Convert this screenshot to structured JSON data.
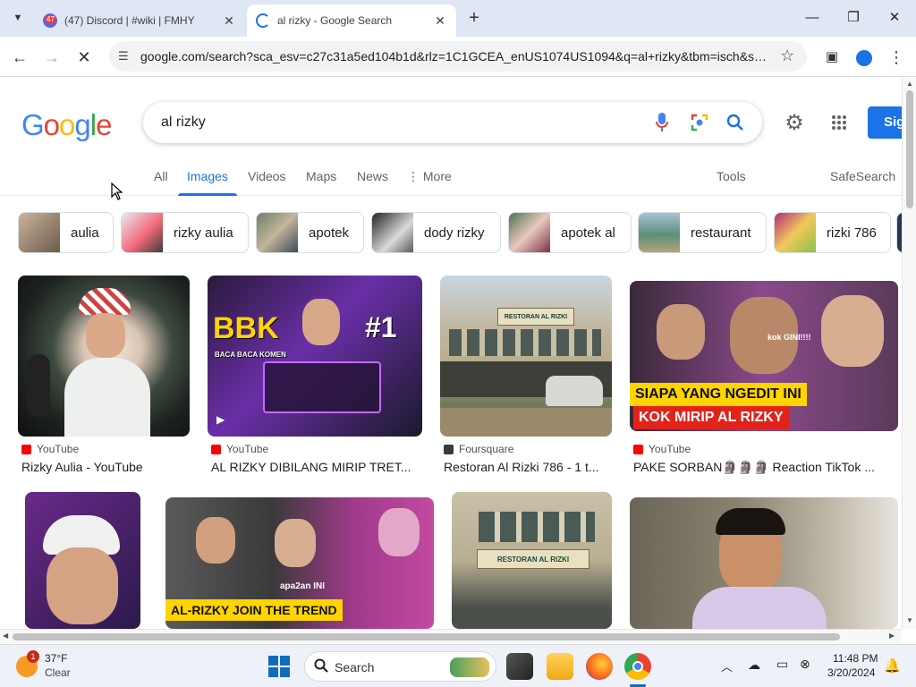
{
  "browser": {
    "tabs": [
      {
        "title": "(47) Discord | #wiki | FMHY",
        "favicon_badge": "47"
      },
      {
        "title": "al rizky - Google Search"
      }
    ],
    "url": "google.com/search?sca_esv=c27c31a5ed104b1d&rlz=1C1GCEA_enUS1074US1094&q=al+rizky&tbm=isch&sour..."
  },
  "google": {
    "logo": "Google",
    "query": "al rizky",
    "sign_in_label": "Sig",
    "tabs": {
      "all": "All",
      "images": "Images",
      "videos": "Videos",
      "maps": "Maps",
      "news": "News",
      "more": "More"
    },
    "tools": "Tools",
    "safesearch": "SafeSearch",
    "chips": [
      "aulia",
      "rizky aulia",
      "apotek",
      "dody rizky",
      "apotek al",
      "restaurant",
      "rizki 786"
    ],
    "results_row1": [
      {
        "source": "YouTube",
        "title": "Rizky Aulia - YouTube"
      },
      {
        "source": "YouTube",
        "title": "AL RIZKY DIBILANG MIRIP TRET...",
        "overlay_big": "BBK",
        "overlay_small": "BACA BACA KOMEN",
        "overlay_num": "#1"
      },
      {
        "source": "Foursquare",
        "title": "Restoran Al Rizki 786 - 1 t...",
        "sign": "RESTORAN AL RIZKI"
      },
      {
        "source": "YouTube",
        "title": "PAKE SORBAN🗿🗿🗿 Reaction TikTok ...",
        "banner1": "SIAPA YANG NGEDIT INI",
        "banner2": "KOK MIRIP AL RIZKY",
        "caption": "kok GINI!!!!"
      }
    ],
    "results_row2": [
      {
        "id": "img5"
      },
      {
        "id": "img6",
        "banner": "AL-RIZKY JOIN THE TREND",
        "caption": "apa2an INI"
      },
      {
        "id": "img7",
        "sign": "RESTORAN AL RIZKI"
      },
      {
        "id": "img8"
      }
    ]
  },
  "taskbar": {
    "weather_temp": "37°F",
    "weather_cond": "Clear",
    "weather_badge": "1",
    "search_label": "Search",
    "time": "11:48 PM",
    "date": "3/20/2024"
  },
  "colors": {
    "accent": "#1a73e8",
    "youtube": "#ff0000",
    "tabstrip": "#dfe7f5"
  }
}
